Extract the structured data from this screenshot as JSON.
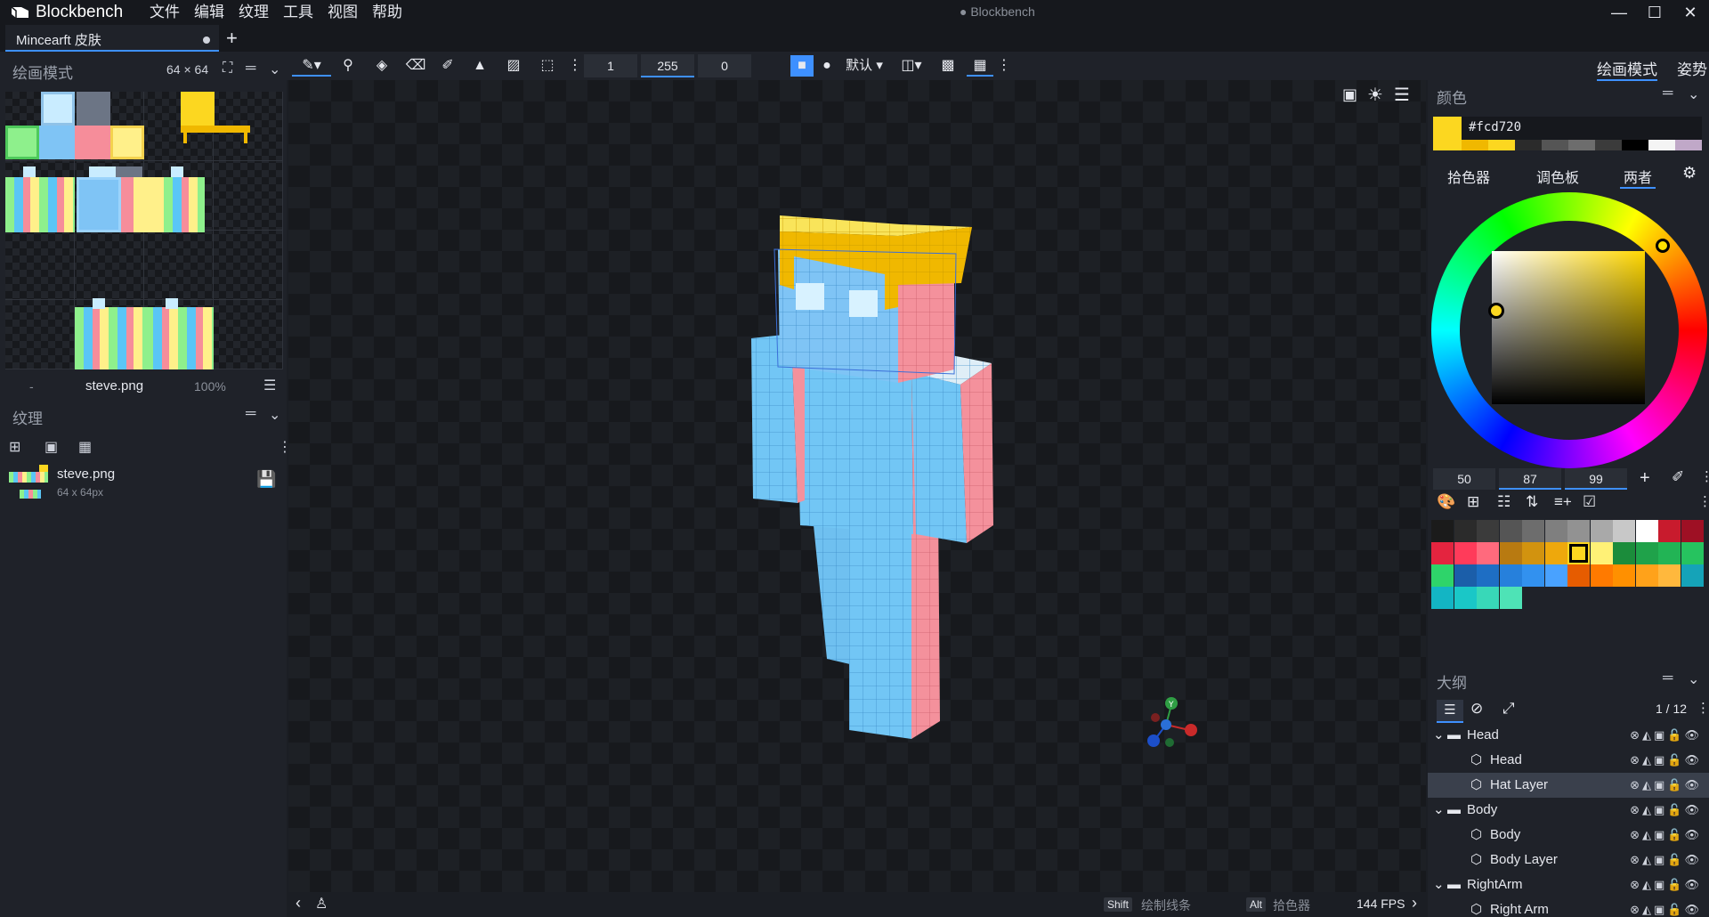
{
  "titlebar": {
    "app_name": "Blockbench",
    "menu": [
      "文件",
      "编辑",
      "纹理",
      "工具",
      "视图",
      "帮助"
    ],
    "window_title": "● Blockbench",
    "minimize": "—",
    "maximize": "☐",
    "close": "✕"
  },
  "tabs": [
    {
      "label": "Mincearft 皮肤",
      "unsaved": true
    }
  ],
  "new_tab": "+",
  "left_panel": {
    "paint_header": "绘画模式",
    "resolution": "64 × 64",
    "uv_footer": {
      "left": "-",
      "texture": "steve.png",
      "zoom": "100%"
    },
    "textures_header": "纹理",
    "texture_item": {
      "name": "steve.png",
      "size": "64 x 64px"
    }
  },
  "toolbar": {
    "brush_size": "1",
    "opacity": "255",
    "softness": "0",
    "blend_mode": "默认"
  },
  "statusbar": {
    "shift_key": "Shift",
    "shift_hint": "绘制线条",
    "alt_key": "Alt",
    "alt_hint": "拾色器",
    "fps": "144 FPS"
  },
  "right_panel": {
    "modes": [
      "绘画模式",
      "姿势"
    ],
    "color_header": "颜色",
    "hex": "#fcd720",
    "main_color": "#fcd720",
    "color_tabs": [
      "拾色器",
      "调色板",
      "两者"
    ],
    "hsv": [
      "50",
      "87",
      "99"
    ],
    "outliner_header": "大纲",
    "outliner_count": "1 / 12",
    "outliner": [
      {
        "label": "Head",
        "type": "folder",
        "indent": 0
      },
      {
        "label": "Head",
        "type": "cube",
        "indent": 1
      },
      {
        "label": "Hat Layer",
        "type": "cube",
        "indent": 1,
        "selected": true
      },
      {
        "label": "Body",
        "type": "folder",
        "indent": 0
      },
      {
        "label": "Body",
        "type": "cube",
        "indent": 1
      },
      {
        "label": "Body Layer",
        "type": "cube",
        "indent": 1
      },
      {
        "label": "RightArm",
        "type": "folder",
        "indent": 0
      },
      {
        "label": "Right Arm",
        "type": "cube",
        "indent": 1
      }
    ],
    "palette": [
      "#1b1b1b",
      "#2b2b2b",
      "#3b3b3b",
      "#555555",
      "#6d6d6d",
      "#7f7f7f",
      "#929292",
      "#a9a9a9",
      "#c8c8c8",
      "#ffffff",
      "#c81b2d",
      "#9e1024",
      "#e4243f",
      "#ff3b5a",
      "#ff6a7d",
      "#b87a11",
      "#d2930f",
      "#eea80c",
      "#fcd720",
      "#fff176",
      "#1b8c3b",
      "#1fa24a",
      "#22b455",
      "#26c35f",
      "#2ed46a",
      "#1b5ea9",
      "#1e6ec4",
      "#2680dc",
      "#3291ef",
      "#49a2ff",
      "#e65c00",
      "#ff7a00",
      "#ff9000",
      "#ffa21a",
      "#ffb83d",
      "#15a3b8",
      "#13b5c4",
      "#1ac7c7",
      "#38d8b8",
      "#4ee3b6"
    ]
  }
}
